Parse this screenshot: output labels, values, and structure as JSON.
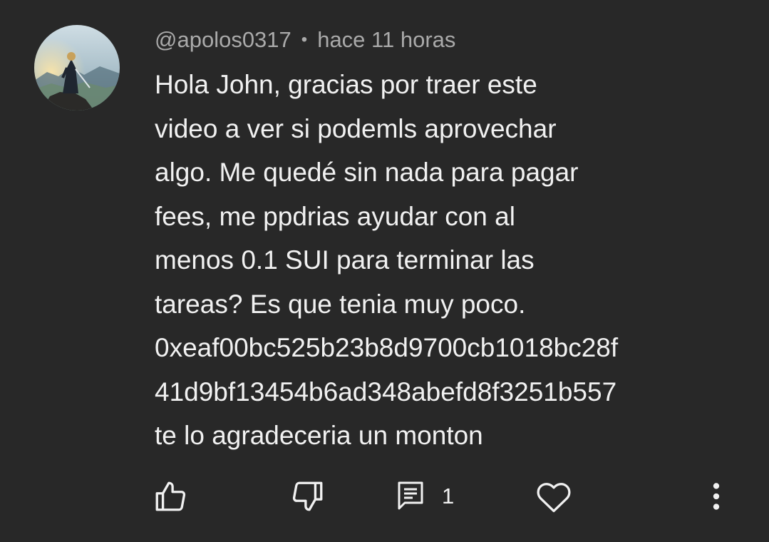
{
  "comment": {
    "author": "@apolos0317",
    "separator": "•",
    "timestamp": "hace 11 horas",
    "body_lines": [
      "Hola John, gracias por traer este",
      "video a ver si podemls aprovechar",
      "algo. Me quedé sin nada para pagar",
      "fees, me ppdrias ayudar con al",
      "menos 0.1 SUI para terminar las",
      "tareas? Es que tenia muy poco.",
      "0xeaf00bc525b23b8d9700cb1018bc28f",
      "41d9bf13454b6ad348abefd8f3251b557",
      "te lo agradeceria un monton"
    ]
  },
  "actions": {
    "like_icon": "thumbs-up-icon",
    "dislike_icon": "thumbs-down-icon",
    "reply_icon": "comment-icon",
    "reply_count": "1",
    "heart_icon": "heart-icon",
    "more_icon": "more-vertical-icon"
  },
  "colors": {
    "background": "#282828",
    "text_primary": "#f1f1f1",
    "text_secondary": "#aaaaaa"
  }
}
